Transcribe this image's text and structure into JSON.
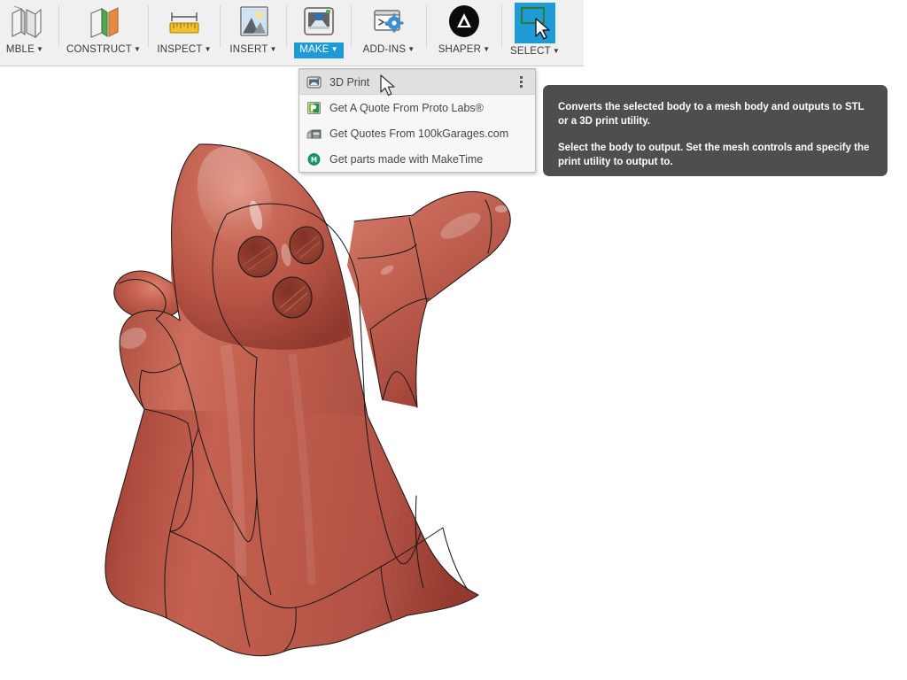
{
  "app": {
    "background_color": "#ffffff",
    "accent_color": "#1e9ad6",
    "toolbar_bg": "#f0f0f0"
  },
  "toolbar": {
    "groups": [
      {
        "label": "MBLE",
        "icon": "assemble-icon",
        "has_caret": true,
        "active": false,
        "selected": false
      },
      {
        "label": "CONSTRUCT",
        "icon": "construct-icon",
        "has_caret": true,
        "active": false,
        "selected": false
      },
      {
        "label": "INSPECT",
        "icon": "measure-ruler-icon",
        "has_caret": true,
        "active": false,
        "selected": false
      },
      {
        "label": "INSERT",
        "icon": "picture-icon",
        "has_caret": true,
        "active": false,
        "selected": false
      },
      {
        "label": "MAKE",
        "icon": "3d-printer-icon",
        "has_caret": true,
        "active": true,
        "selected": false
      },
      {
        "label": "ADD-INS",
        "icon": "script-gear-icon",
        "has_caret": true,
        "active": false,
        "selected": false
      },
      {
        "label": "SHAPER",
        "icon": "shaper-triangle-icon",
        "has_caret": true,
        "active": false,
        "selected": false
      },
      {
        "label": "SELECT",
        "icon": "select-window-icon",
        "has_caret": true,
        "active": false,
        "selected": true
      }
    ]
  },
  "make_menu": {
    "items": [
      {
        "label": "3D Print",
        "icon": "3d-print-icon",
        "highlighted": true,
        "has_overflow": true
      },
      {
        "label": "Get A Quote From Proto Labs®",
        "icon": "proto-labs-icon",
        "highlighted": false,
        "has_overflow": false
      },
      {
        "label": "Get Quotes From 100kGarages.com",
        "icon": "100kgarages-icon",
        "highlighted": false,
        "has_overflow": false
      },
      {
        "label": "Get parts made with MakeTime",
        "icon": "maketime-icon",
        "highlighted": false,
        "has_overflow": false
      }
    ]
  },
  "tooltip": {
    "paragraph_1": "Converts the selected body to a mesh body and outputs to STL or a 3D print utility.",
    "paragraph_2": "Select the body to output. Set the mesh controls and specify the print utility to output to.",
    "background_color": "#4e4e4e"
  },
  "model": {
    "name": "ghost-body",
    "material_color": "#bd5a4c",
    "edge_color": "#1a1a1a",
    "description": "Shaded 3D ghost-shaped solid body with two eye cutouts and one mouth cutout"
  }
}
